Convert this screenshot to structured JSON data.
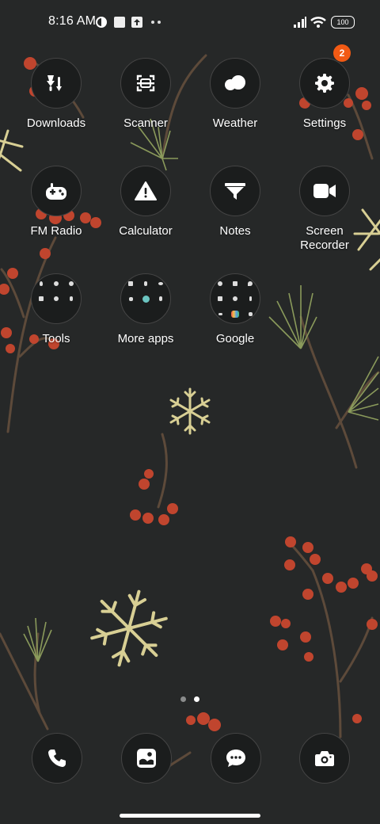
{
  "status_bar": {
    "time": "8:16 AM",
    "battery": "100",
    "left_icons": [
      "notification-circle-icon",
      "square-notification-icon",
      "upload-icon",
      "more-dots-icon"
    ],
    "right_icons": [
      "signal-icon",
      "wifi-icon",
      "battery-icon"
    ]
  },
  "apps": [
    {
      "label": "Downloads",
      "icon": "download-icon"
    },
    {
      "label": "Scanner",
      "icon": "scanner-icon"
    },
    {
      "label": "Weather",
      "icon": "cloud-icon"
    },
    {
      "label": "Settings",
      "icon": "gear-icon",
      "badge": "2"
    },
    {
      "label": "FM Radio",
      "icon": "gamepad-icon"
    },
    {
      "label": "Calculator",
      "icon": "warning-icon"
    },
    {
      "label": "Notes",
      "icon": "funnel-icon"
    },
    {
      "label": "Screen\nRecorder",
      "icon": "video-camera-icon"
    },
    {
      "label": "Tools",
      "icon": "folder-icon"
    },
    {
      "label": "More apps",
      "icon": "folder-icon"
    },
    {
      "label": "Google",
      "icon": "folder-icon"
    }
  ],
  "dock": [
    {
      "name": "phone",
      "icon": "phone-icon"
    },
    {
      "name": "gallery",
      "icon": "gallery-icon"
    },
    {
      "name": "messages",
      "icon": "message-icon"
    },
    {
      "name": "camera",
      "icon": "camera-icon"
    }
  ],
  "pager": {
    "pages": 2,
    "current": 2
  },
  "colors": {
    "background": "#262828",
    "badge": "#f25a14",
    "berry": "#c0452e",
    "pine": "#8a9a5b",
    "snowflake": "#d8cf94",
    "branch": "#5d4a3a"
  }
}
